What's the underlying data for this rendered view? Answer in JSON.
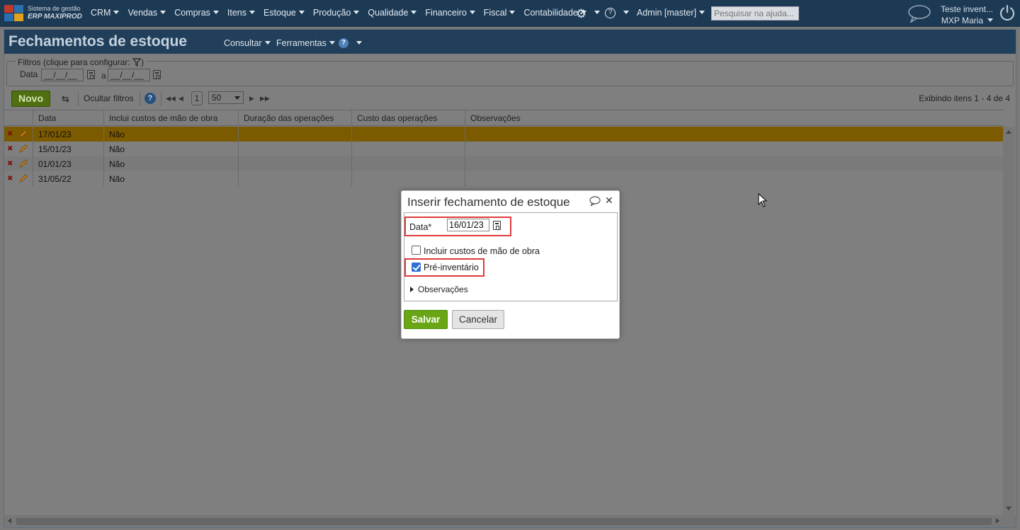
{
  "topbar": {
    "brand_line1": "Sistema de gestão",
    "brand_line2": "ERP MAXIPROD",
    "nav": [
      "CRM",
      "Vendas",
      "Compras",
      "Itens",
      "Estoque",
      "Produção",
      "Qualidade",
      "Financeiro",
      "Fiscal",
      "Contabilidade"
    ],
    "settings_icon": "gear-icon",
    "help_icon": "help-icon",
    "user_menu": "Admin [master]",
    "search_placeholder": "Pesquisar na ajuda...",
    "company": "Teste invent...",
    "user_name": "MXP Maria"
  },
  "page": {
    "title": "Fechamentos de estoque",
    "menu_consultar": "Consultar",
    "menu_ferramentas": "Ferramentas"
  },
  "filters": {
    "legend": "Filtros (clique para configurar:",
    "legend_close": ")",
    "date_label": "Data",
    "date_from": "__/__/__",
    "date_to": "__/__/__",
    "between": "a"
  },
  "toolbar": {
    "new_label": "Novo",
    "hide_filters": "Ocultar filtros",
    "page_number": "1",
    "per_page": "50",
    "status": "Exibindo itens 1 - 4 de 4"
  },
  "grid": {
    "columns": [
      "Data",
      "Inclui custos de mão de obra",
      "Duração das operações",
      "Custo das operações",
      "Observações"
    ],
    "rows": [
      {
        "data": "17/01/23",
        "inclui": "Não",
        "duracao": "",
        "custo": "",
        "obs": "",
        "selected": true
      },
      {
        "data": "15/01/23",
        "inclui": "Não",
        "duracao": "",
        "custo": "",
        "obs": "",
        "selected": false
      },
      {
        "data": "01/01/23",
        "inclui": "Não",
        "duracao": "",
        "custo": "",
        "obs": "",
        "selected": false
      },
      {
        "data": "31/05/22",
        "inclui": "Não",
        "duracao": "",
        "custo": "",
        "obs": "",
        "selected": false
      }
    ]
  },
  "dialog": {
    "title": "Inserir fechamento de estoque",
    "date_label": "Data*",
    "date_value": "16/01/23",
    "labor_costs_label": "Incluir custos de mão de obra",
    "labor_costs_checked": false,
    "pre_inventory_label": "Pré-inventário",
    "pre_inventory_checked": true,
    "notes_label": "Observações",
    "save_label": "Salvar",
    "cancel_label": "Cancelar"
  },
  "colors": {
    "topbar": "#1d3a55",
    "selected_row": "#7c5a00",
    "save_button": "#6aa515",
    "highlight": "#e03a3a"
  }
}
